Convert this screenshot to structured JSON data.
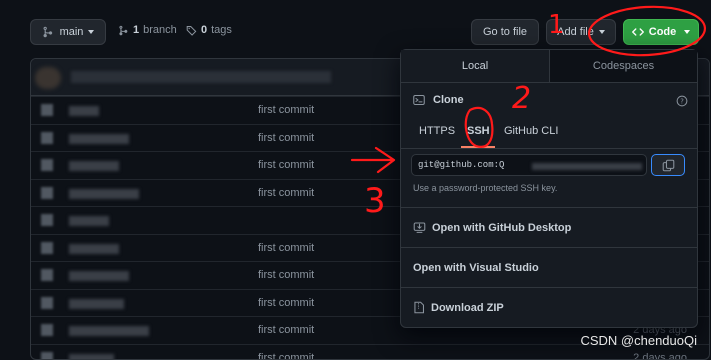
{
  "toolbar": {
    "branch_label": "main",
    "branches_count": "1",
    "branches_label": "branch",
    "tags_count": "0",
    "tags_label": "tags",
    "go_to_file": "Go to file",
    "add_file": "Add file",
    "code": "Code"
  },
  "files": [
    {
      "message": "first commit",
      "ago": ""
    },
    {
      "message": "first commit",
      "ago": ""
    },
    {
      "message": "first commit",
      "ago": ""
    },
    {
      "message": "first commit",
      "ago": ""
    },
    {
      "message": "",
      "ago": ""
    },
    {
      "message": "first commit",
      "ago": ""
    },
    {
      "message": "first commit",
      "ago": ""
    },
    {
      "message": "first commit",
      "ago": ""
    },
    {
      "message": "first commit",
      "ago": "2 days ago"
    },
    {
      "message": "first commit",
      "ago": "2 days ago"
    }
  ],
  "dropdown": {
    "tab_local": "Local",
    "tab_codespaces": "Codespaces",
    "clone_title": "Clone",
    "protocols": [
      "HTTPS",
      "SSH",
      "GitHub CLI"
    ],
    "url_prefix": "git@github.com:Q",
    "hint": "Use a password-protected SSH key.",
    "open_desktop": "Open with GitHub Desktop",
    "open_vs": "Open with Visual Studio",
    "download_zip": "Download ZIP"
  },
  "annotations": {
    "num1": "1",
    "num2": "2",
    "num3": "3"
  },
  "watermark": "CSDN @chenduoQi",
  "colors": {
    "code_button": "#2ea043",
    "annotation": "#ff1a1a",
    "focus_border": "#388bfd"
  }
}
